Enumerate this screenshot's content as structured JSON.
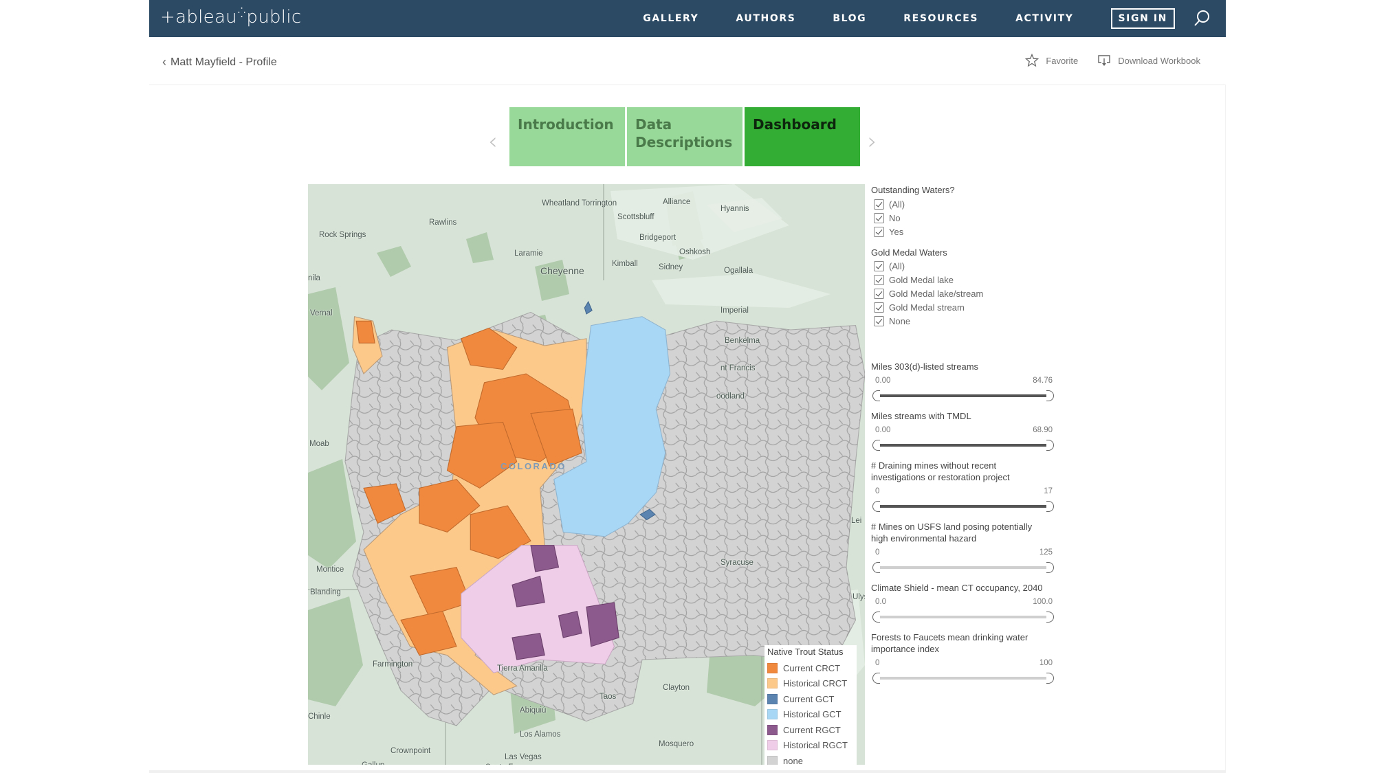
{
  "header": {
    "logo_text": "+ableau",
    "logo_suffix": "public",
    "nav": [
      "GALLERY",
      "AUTHORS",
      "BLOG",
      "RESOURCES",
      "ACTIVITY"
    ],
    "sign_in": "SIGN IN"
  },
  "subheader": {
    "back_label": "Matt Mayfield - Profile",
    "favorite": "Favorite",
    "download": "Download Workbook"
  },
  "story": {
    "tabs": [
      {
        "label": "Introduction",
        "active": false
      },
      {
        "label": "Data Descriptions",
        "active": false
      },
      {
        "label": "Dashboard",
        "active": true
      }
    ]
  },
  "map": {
    "labels": [
      {
        "text": "Wheatland",
        "size": "normal"
      },
      {
        "text": "Torrington",
        "size": "normal"
      },
      {
        "text": "Alliance",
        "size": "normal"
      },
      {
        "text": "Hyannis",
        "size": "normal"
      },
      {
        "text": "Rawlins",
        "size": "normal"
      },
      {
        "text": "Scottsbluff",
        "size": "normal"
      },
      {
        "text": "Bridgeport",
        "size": "normal"
      },
      {
        "text": "Rock Springs",
        "size": "normal"
      },
      {
        "text": "Oshkosh",
        "size": "normal"
      },
      {
        "text": "Laramie",
        "size": "normal"
      },
      {
        "text": "Kimball",
        "size": "normal"
      },
      {
        "text": "Cheyenne",
        "size": "big"
      },
      {
        "text": "Sidney",
        "size": "normal"
      },
      {
        "text": "Ogallala",
        "size": "normal"
      },
      {
        "text": "nila",
        "size": "normal"
      },
      {
        "text": "Vernal",
        "size": "normal"
      },
      {
        "text": "Imperial",
        "size": "normal"
      },
      {
        "text": "Benkelma",
        "size": "normal"
      },
      {
        "text": "nt Francis",
        "size": "normal"
      },
      {
        "text": "oodland",
        "size": "normal"
      },
      {
        "text": "COLORADO",
        "size": "state"
      },
      {
        "text": "Moab",
        "size": "normal"
      },
      {
        "text": "Lei",
        "size": "normal"
      },
      {
        "text": "Syracuse",
        "size": "normal"
      },
      {
        "text": "Montice",
        "size": "normal"
      },
      {
        "text": "Blanding",
        "size": "normal"
      },
      {
        "text": "Ulys",
        "size": "normal"
      },
      {
        "text": "Farmington",
        "size": "normal"
      },
      {
        "text": "Tierra Amarilla",
        "size": "normal"
      },
      {
        "text": "Clayton",
        "size": "normal"
      },
      {
        "text": "Taos",
        "size": "normal"
      },
      {
        "text": "Abiquiú",
        "size": "normal"
      },
      {
        "text": "Chinle",
        "size": "normal"
      },
      {
        "text": "Los Alamos",
        "size": "normal"
      },
      {
        "text": "Mosquero",
        "size": "normal"
      },
      {
        "text": "Crownpoint",
        "size": "normal"
      },
      {
        "text": "Las Vegas",
        "size": "normal"
      },
      {
        "text": "Gallup",
        "size": "normal"
      },
      {
        "text": "Santa Fe",
        "size": "normal"
      }
    ],
    "legend": {
      "title": "Native Trout Status",
      "items": [
        {
          "label": "Current CRCT",
          "color": "#f0883e"
        },
        {
          "label": "Historical CRCT",
          "color": "#fdc98a"
        },
        {
          "label": "Current GCT",
          "color": "#5b84b1"
        },
        {
          "label": "Historical GCT",
          "color": "#a8d6f5"
        },
        {
          "label": "Current RGCT",
          "color": "#8c5a8c"
        },
        {
          "label": "Historical RGCT",
          "color": "#efcce8"
        },
        {
          "label": "none",
          "color": "#d3d3d3"
        }
      ]
    }
  },
  "filters": {
    "outstanding": {
      "title": "Outstanding Waters?",
      "options": [
        {
          "label": "(All)",
          "checked": true
        },
        {
          "label": "No",
          "checked": true
        },
        {
          "label": "Yes",
          "checked": true
        }
      ]
    },
    "gold_medal": {
      "title": "Gold Medal Waters",
      "options": [
        {
          "label": "(All)",
          "checked": true
        },
        {
          "label": "Gold Medal lake",
          "checked": true
        },
        {
          "label": "Gold Medal lake/stream",
          "checked": true
        },
        {
          "label": "Gold Medal stream",
          "checked": true
        },
        {
          "label": "None",
          "checked": true
        }
      ]
    },
    "sliders": [
      {
        "title": "Miles 303(d)-listed streams",
        "min": "0.00",
        "max": "84.76",
        "style": "dark"
      },
      {
        "title": "Miles streams with TMDL",
        "min": "0.00",
        "max": "68.90",
        "style": "dark"
      },
      {
        "title": "# Draining mines without recent investigations or restoration project",
        "min": "0",
        "max": "17",
        "style": "dark"
      },
      {
        "title": "# Mines on USFS land posing potentially high environmental hazard",
        "min": "0",
        "max": "125",
        "style": "light"
      },
      {
        "title": "Climate Shield - mean CT occupancy, 2040",
        "min": "0.0",
        "max": "100.0",
        "style": "light"
      },
      {
        "title": "Forests to Faucets  mean drinking water importance index",
        "min": "0",
        "max": "100",
        "style": "light"
      }
    ]
  }
}
